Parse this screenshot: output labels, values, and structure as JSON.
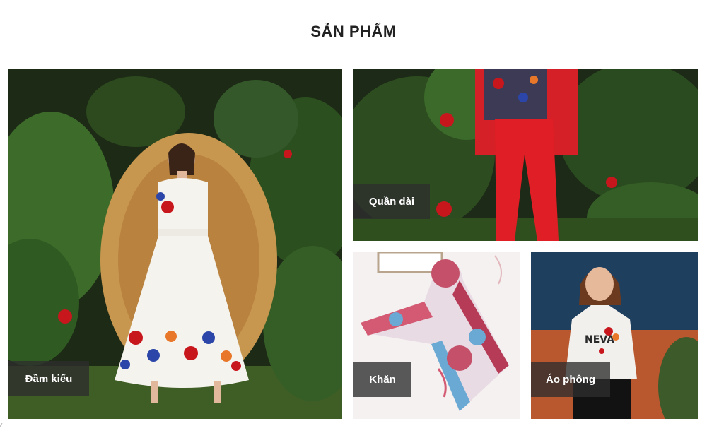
{
  "section": {
    "title": "SẢN PHẨM"
  },
  "categories": [
    {
      "label": "Đầm kiểu"
    },
    {
      "label": "Quần dài"
    },
    {
      "label": "Khăn"
    },
    {
      "label": "Áo phông"
    }
  ],
  "colors": {
    "label_bg": "#2d2d2d",
    "label_text": "#ffffff",
    "title_text": "#222222"
  },
  "icons": {
    "corner": "broken-image-icon"
  }
}
